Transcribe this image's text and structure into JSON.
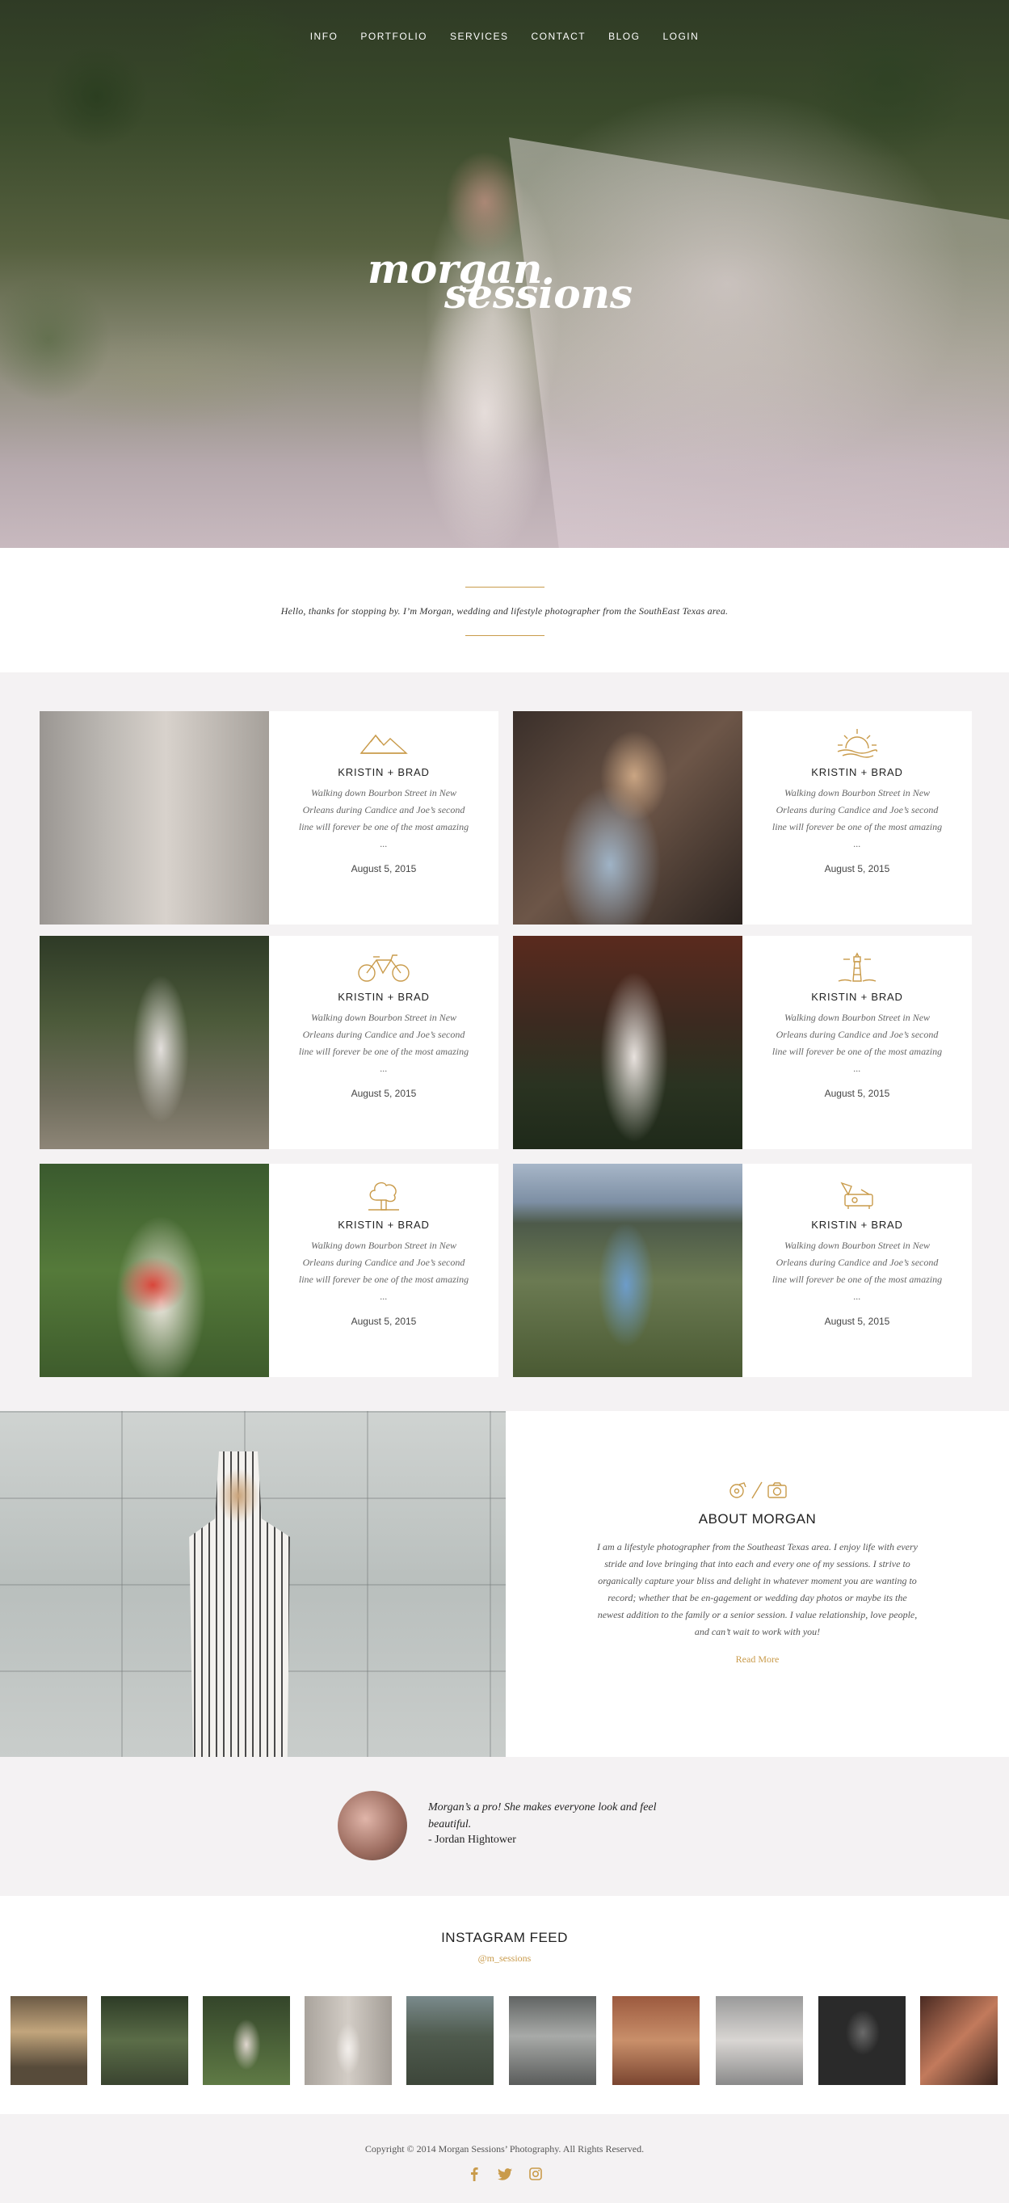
{
  "nav": [
    "INFO",
    "PORTFOLIO",
    "SERVICES",
    "CONTACT",
    "BLOG",
    "LOGIN"
  ],
  "logo": {
    "line1": "morgan",
    "line2": "sessions"
  },
  "intro": "Hello, thanks for stopping by. I’m Morgan, wedding and lifestyle photographer from the SouthEast Texas area.",
  "posts": [
    {
      "icon": "mountain-icon",
      "title": "KRISTIN + BRAD",
      "excerpt": "Walking down Bourbon Street in New Orleans during Candice and Joe’s second line will forever be one of the most amazing ...",
      "date": "August 5, 2015"
    },
    {
      "icon": "sun-icon",
      "title": "KRISTIN + BRAD",
      "excerpt": "Walking down Bourbon Street in New Orleans during Candice and Joe’s second line will forever be one of the most amazing ...",
      "date": "August 5, 2015"
    },
    {
      "icon": "bicycle-icon",
      "title": "KRISTIN + BRAD",
      "excerpt": "Walking down Bourbon Street in New Orleans during Candice and Joe’s second line will forever be one of the most amazing ...",
      "date": "August 5, 2015"
    },
    {
      "icon": "lighthouse-icon",
      "title": "KRISTIN + BRAD",
      "excerpt": "Walking down Bourbon Street in New Orleans during Candice and Joe’s second line will forever be one of the most amazing ...",
      "date": "August 5, 2015"
    },
    {
      "icon": "tree-icon",
      "title": "KRISTIN + BRAD",
      "excerpt": "Walking down Bourbon Street in New Orleans during Candice and Joe’s second line will forever be one of the most amazing ...",
      "date": "August 5, 2015"
    },
    {
      "icon": "record-player-icon",
      "title": "KRISTIN + BRAD",
      "excerpt": "Walking down Bourbon Street in New Orleans during Candice and Joe’s second line will forever be one of the most amazing ...",
      "date": "August 5, 2015"
    }
  ],
  "about": {
    "title": "ABOUT MORGAN",
    "text": "I am a lifestyle photographer from the Southeast Texas area. I enjoy life with every stride and love bringing that into each and every one of my sessions. I strive to organically capture your bliss and delight in whatever moment you are wanting to record; whether that be en-gagement or wedding day photos or maybe its the newest addition to the family or a senior session. I value relationship, love people, and can’t wait to work with you!",
    "more": "Read More"
  },
  "testimonial": {
    "quote": "Morgan’s a pro! She makes everyone look and feel beautiful.",
    "author": "- Jordan Hightower"
  },
  "instagram": {
    "title": "INSTAGRAM FEED",
    "handle": "@m_sessions"
  },
  "footer": {
    "copyright": "Copyright © 2014 Morgan Sessions’ Photography. All Rights Reserved.",
    "social": [
      "facebook-icon",
      "twitter-icon",
      "instagram-icon"
    ]
  },
  "colors": {
    "accent": "#c99b4b",
    "background": "#f4f2f3",
    "card": "#ffffff"
  }
}
